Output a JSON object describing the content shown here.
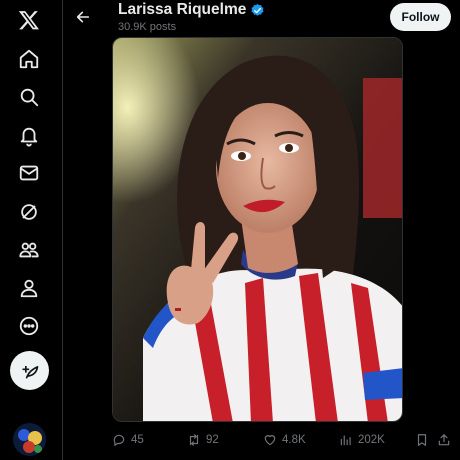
{
  "profile": {
    "name": "Larissa Riquelme",
    "posts_count": "30.9K posts",
    "follow_label": "Follow"
  },
  "actions": {
    "replies": "45",
    "reposts": "92",
    "likes": "4.8K",
    "views": "202K"
  },
  "nav": [
    "x-logo-icon",
    "home-icon",
    "search-icon",
    "notifications-icon",
    "messages-icon",
    "grok-icon",
    "communities-icon",
    "profile-icon",
    "more-icon"
  ],
  "colors": {
    "background": "#000000",
    "verified": "#1d9bf0",
    "muted": "#71767b",
    "follow_bg": "#eff3f4"
  }
}
